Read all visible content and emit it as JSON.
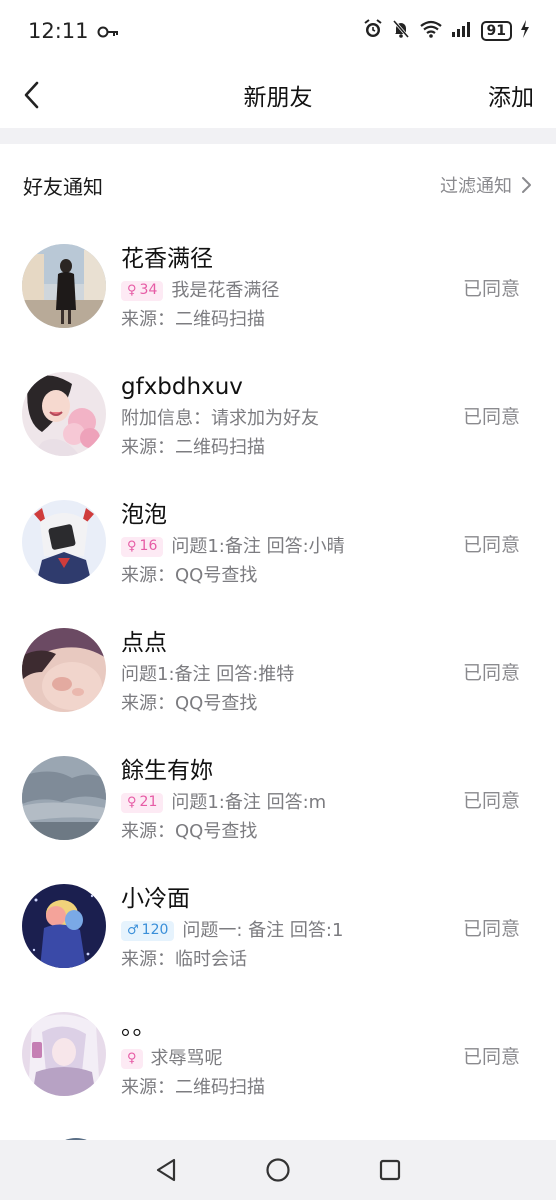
{
  "status_bar": {
    "time": "12:11",
    "battery": "91"
  },
  "nav": {
    "title": "新朋友",
    "add_label": "添加"
  },
  "section": {
    "title": "好友通知",
    "filter_label": "过滤通知"
  },
  "requests": [
    {
      "name": "花香满径",
      "gender": "female",
      "age": "34",
      "message": "我是花香满径",
      "source": "来源：二维码扫描",
      "status": "已同意",
      "avatar": "woman-street-photo"
    },
    {
      "name": "gfxbdhxuv",
      "gender": "",
      "age": "",
      "message": "附加信息：请求加为好友",
      "source": "来源：二维码扫描",
      "status": "已同意",
      "avatar": "anime-girl-flowers"
    },
    {
      "name": "泡泡",
      "gender": "female",
      "age": "16",
      "message": "问题1:备注 回答:小晴",
      "source": "来源：QQ号查找",
      "status": "已同意",
      "avatar": "anime-cat-girl"
    },
    {
      "name": "点点",
      "gender": "",
      "age": "",
      "message": "问题1:备注 回答:推特",
      "source": "来源：QQ号查找",
      "status": "已同意",
      "avatar": "blurred-photo"
    },
    {
      "name": "餘生有妳",
      "gender": "female",
      "age": "21",
      "message": "问题1:备注 回答:m",
      "source": "来源：QQ号查找",
      "status": "已同意",
      "avatar": "cloudy-sky"
    },
    {
      "name": "小冷面",
      "gender": "male",
      "age": "120",
      "message": "问题一: 备注 回答:1",
      "source": "来源：临时会话",
      "status": "已同意",
      "avatar": "anime-couple-night"
    },
    {
      "name": "。。",
      "gender": "female",
      "age": "",
      "message": "求辱骂呢",
      "source": "来源：二维码扫描",
      "status": "已同意",
      "avatar": "anime-white-hair-girl"
    }
  ],
  "colors": {
    "female_tag": "#e65ba5",
    "male_tag": "#3a8fd9",
    "muted_text": "#7c7c80"
  }
}
